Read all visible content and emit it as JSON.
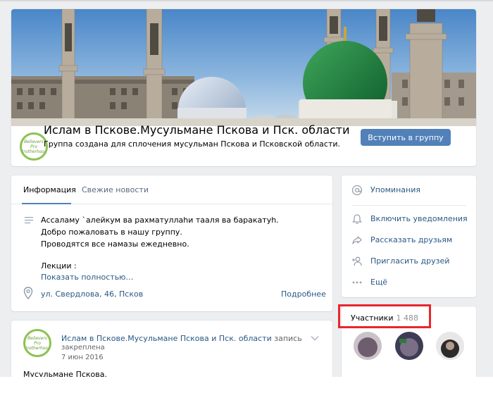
{
  "group": {
    "title": "Ислам в Пскове.Мусульмане Пскова и Пск. области",
    "status": "Группа создана для сплочения мусульман Пскова и Псковской области.",
    "join_label": "Вступить в группу",
    "avatar_text": "Believers Pro Brotherhood"
  },
  "tabs": [
    {
      "label": "Информация"
    },
    {
      "label": "Свежие новости"
    }
  ],
  "info": {
    "lines": [
      "Ассаламу `алейкум ва рахматуллаhи тааля ва баракатуh.",
      "Добро пожаловать в нашу группу.",
      "Проводятся все намазы ежедневно.",
      "Лекции :"
    ],
    "show_more": "Показать полностью…",
    "address": "ул. Свердлова, 46, Псков",
    "address_more": "Подробнее"
  },
  "post": {
    "author": "Ислам в Пскове.Мусульмане Пскова и Пск. области",
    "author_suffix": " запись",
    "pinned": "закреплена",
    "date": "7 июн 2016",
    "text": "Мусульмане Пскова."
  },
  "sidebar": {
    "items": [
      {
        "label": "Упоминания",
        "icon": "at-icon"
      },
      {
        "label": "Включить уведомления",
        "icon": "bell-icon"
      },
      {
        "label": "Рассказать друзьям",
        "icon": "share-icon"
      },
      {
        "label": "Пригласить друзей",
        "icon": "add-user-icon"
      },
      {
        "label": "Ещё",
        "icon": "more-icon"
      }
    ]
  },
  "members": {
    "label": "Участники",
    "count": "1 488"
  },
  "colors": {
    "accent": "#5181b8",
    "link": "#2a5885",
    "highlight": "#e8262d"
  }
}
